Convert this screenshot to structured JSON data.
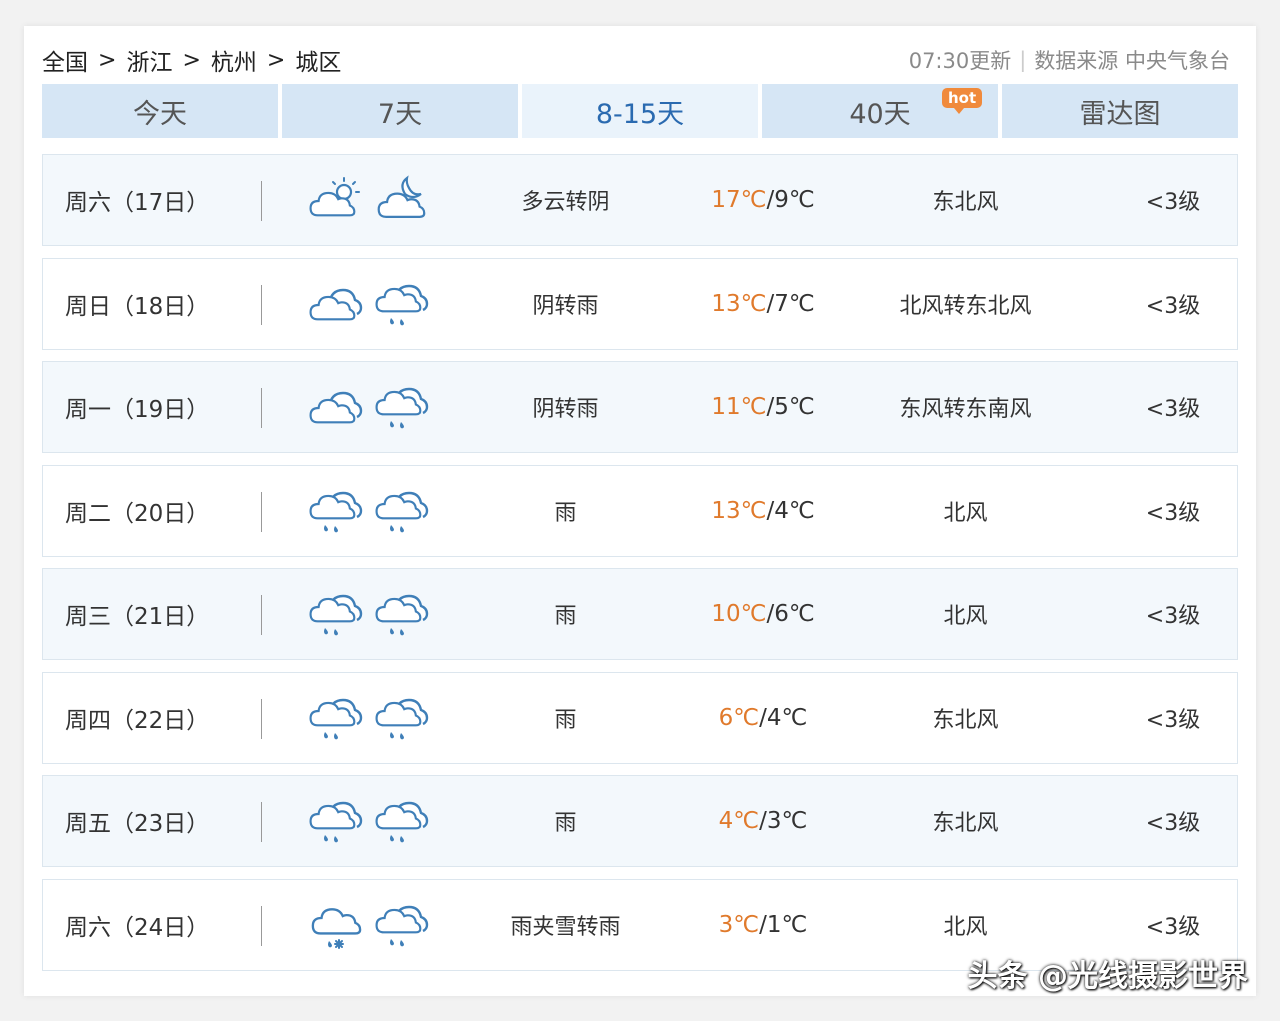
{
  "breadcrumb": [
    "全国",
    "浙江",
    "杭州",
    "城区"
  ],
  "breadcrumb_sep": ">",
  "update_time": "07:30更新",
  "source": "数据来源 中央气象台",
  "tabs": [
    {
      "label": "今天",
      "active": false
    },
    {
      "label": "7天",
      "active": false
    },
    {
      "label": "8-15天",
      "active": true
    },
    {
      "label": "40天",
      "active": false,
      "badge": "hot"
    },
    {
      "label": "雷达图",
      "active": false
    }
  ],
  "days": [
    {
      "date": "周六（17日）",
      "icons": [
        "partly-cloudy-day-icon",
        "partly-cloudy-night-icon"
      ],
      "desc": "多云转阴",
      "high": "17℃",
      "low": "9℃",
      "wind": "东北风",
      "level": "<3级"
    },
    {
      "date": "周日（18日）",
      "icons": [
        "overcast-icon",
        "rain-icon"
      ],
      "desc": "阴转雨",
      "high": "13℃",
      "low": "7℃",
      "wind": "北风转东北风",
      "level": "<3级"
    },
    {
      "date": "周一（19日）",
      "icons": [
        "overcast-icon",
        "rain-icon"
      ],
      "desc": "阴转雨",
      "high": "11℃",
      "low": "5℃",
      "wind": "东风转东南风",
      "level": "<3级"
    },
    {
      "date": "周二（20日）",
      "icons": [
        "rain-icon",
        "rain-icon"
      ],
      "desc": "雨",
      "high": "13℃",
      "low": "4℃",
      "wind": "北风",
      "level": "<3级"
    },
    {
      "date": "周三（21日）",
      "icons": [
        "rain-icon",
        "rain-icon"
      ],
      "desc": "雨",
      "high": "10℃",
      "low": "6℃",
      "wind": "北风",
      "level": "<3级"
    },
    {
      "date": "周四（22日）",
      "icons": [
        "rain-icon",
        "rain-icon"
      ],
      "desc": "雨",
      "high": "6℃",
      "low": "4℃",
      "wind": "东北风",
      "level": "<3级"
    },
    {
      "date": "周五（23日）",
      "icons": [
        "rain-icon",
        "rain-icon"
      ],
      "desc": "雨",
      "high": "4℃",
      "low": "3℃",
      "wind": "东北风",
      "level": "<3级"
    },
    {
      "date": "周六（24日）",
      "icons": [
        "sleet-icon",
        "rain-icon"
      ],
      "desc": "雨夹雪转雨",
      "high": "3℃",
      "low": "1℃",
      "wind": "北风",
      "level": "<3级"
    }
  ],
  "temp_sep": "/",
  "watermark": "头条 @光线摄影世界",
  "colors": {
    "tab_bg": "#d6e6f5",
    "tab_active_bg": "#eaf3fb",
    "tab_active_text": "#2a6ab0",
    "high_temp": "#e07a2c",
    "hot_badge": "#f08a3c",
    "icon_stroke": "#3f7fb8"
  }
}
